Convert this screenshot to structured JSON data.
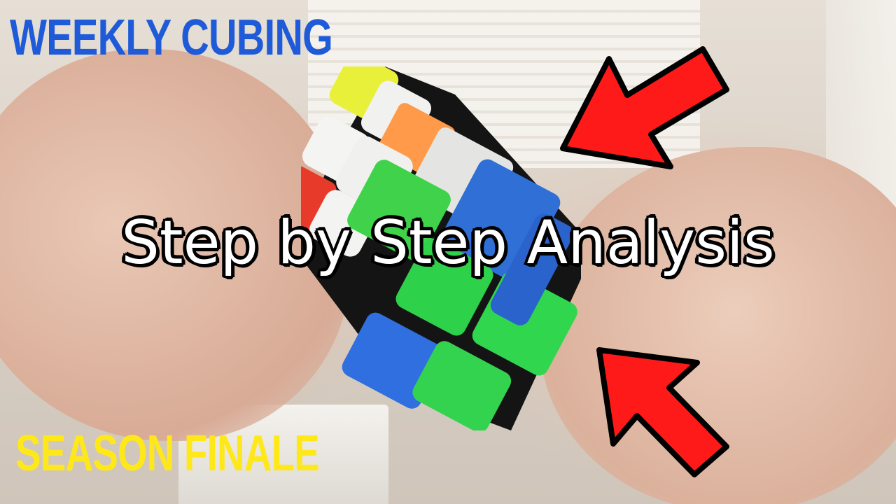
{
  "overlay": {
    "top_title": "WEEKLY CUBING",
    "headline": "Step by Step Analysis",
    "bottom_title": "SEASON FINALE"
  },
  "colors": {
    "top_title": "#1f5bd8",
    "bottom_title": "#ffe81a",
    "headline_fill": "#ffffff",
    "headline_outline": "#000000",
    "arrow_fill": "#ff1a1a",
    "arrow_outline": "#000000"
  },
  "icons": {
    "top_arrow": "arrow-pointing-down-left",
    "bottom_arrow": "arrow-pointing-up-left"
  },
  "cube": {
    "stickers_visible": [
      "yellow",
      "white",
      "orange",
      "white",
      "white",
      "green",
      "blue",
      "red",
      "blue",
      "green"
    ]
  }
}
